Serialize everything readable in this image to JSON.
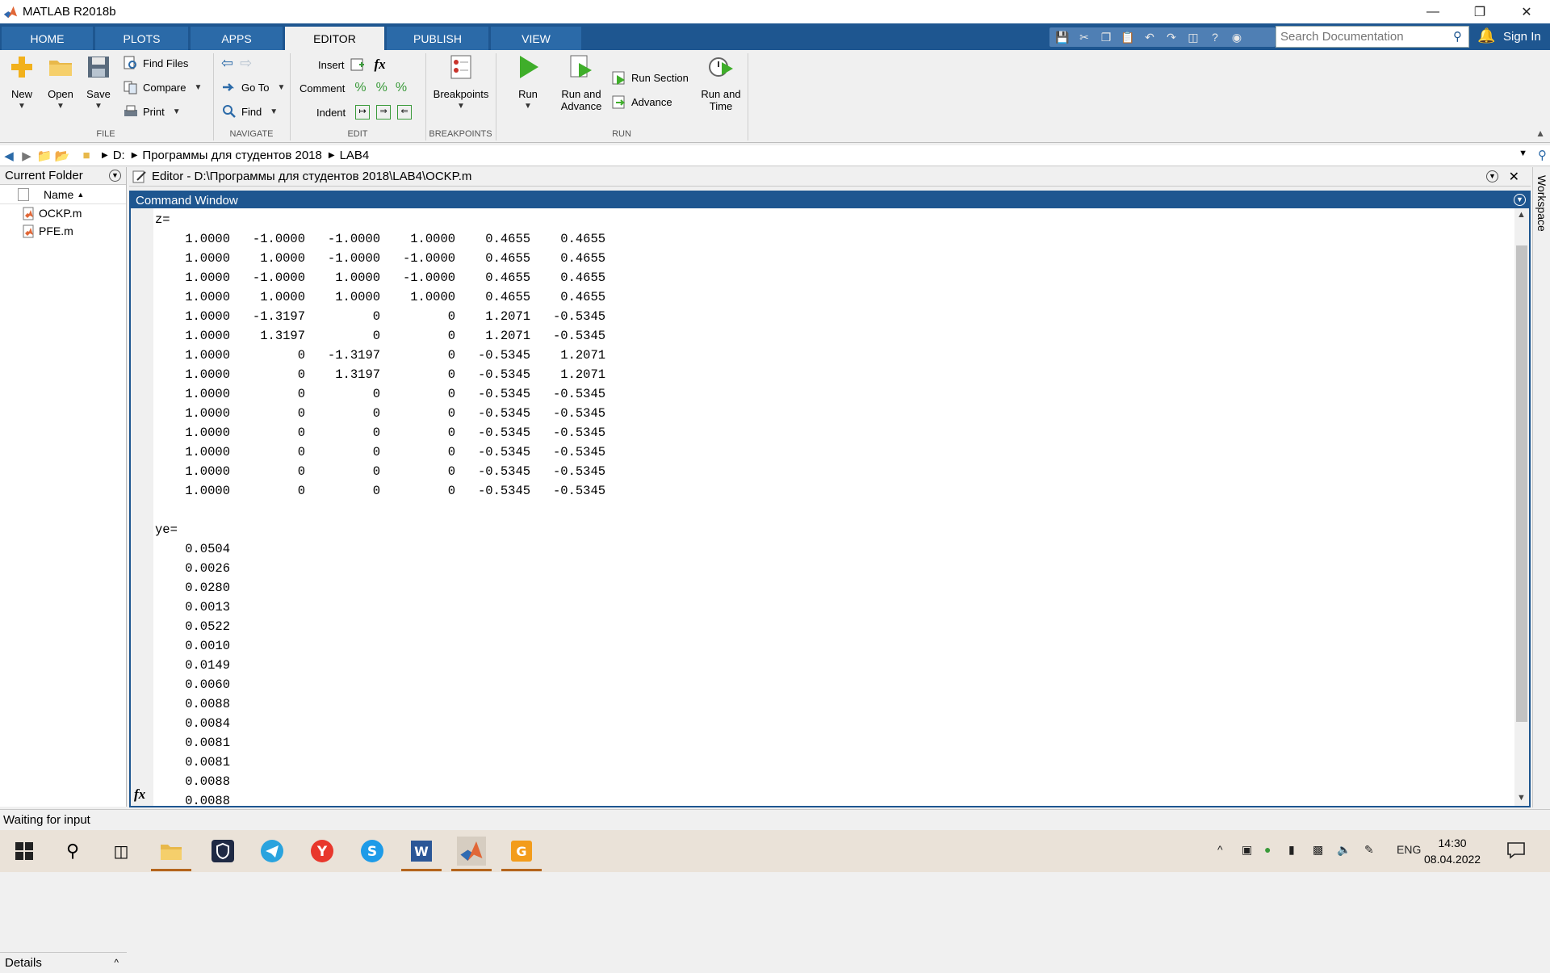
{
  "window": {
    "title": "MATLAB R2018b"
  },
  "tabs": [
    "HOME",
    "PLOTS",
    "APPS",
    "EDITOR",
    "PUBLISH",
    "VIEW"
  ],
  "active_tab": "EDITOR",
  "search": {
    "placeholder": "Search Documentation"
  },
  "signin": "Sign In",
  "ribbon": {
    "file": {
      "group": "FILE",
      "new": "New",
      "open": "Open",
      "save": "Save",
      "find_files": "Find Files",
      "compare": "Compare",
      "print": "Print"
    },
    "navigate": {
      "group": "NAVIGATE",
      "go_to": "Go To",
      "find": "Find"
    },
    "edit": {
      "group": "EDIT",
      "insert": "Insert",
      "comment": "Comment",
      "indent": "Indent"
    },
    "breakpoints": {
      "group": "BREAKPOINTS",
      "label": "Breakpoints"
    },
    "run": {
      "group": "RUN",
      "run": "Run",
      "run_and_advance_1": "Run and",
      "run_and_advance_2": "Advance",
      "run_section": "Run Section",
      "advance": "Advance",
      "run_and_time_1": "Run and",
      "run_and_time_2": "Time"
    }
  },
  "address": {
    "crumbs": [
      "D:",
      "Программы для студентов 2018",
      "LAB4"
    ]
  },
  "current_folder": {
    "title": "Current Folder",
    "column": "Name",
    "files": [
      "OCKP.m",
      "PFE.m"
    ],
    "details": "Details"
  },
  "editor": {
    "title": "Editor - D:\\Программы для студентов 2018\\LAB4\\OCKP.m"
  },
  "workspace_tab": "Workspace",
  "command_window": {
    "title": "Command Window",
    "lines": [
      "z=",
      "    1.0000   -1.0000   -1.0000    1.0000    0.4655    0.4655",
      "    1.0000    1.0000   -1.0000   -1.0000    0.4655    0.4655",
      "    1.0000   -1.0000    1.0000   -1.0000    0.4655    0.4655",
      "    1.0000    1.0000    1.0000    1.0000    0.4655    0.4655",
      "    1.0000   -1.3197         0         0    1.2071   -0.5345",
      "    1.0000    1.3197         0         0    1.2071   -0.5345",
      "    1.0000         0   -1.3197         0   -0.5345    1.2071",
      "    1.0000         0    1.3197         0   -0.5345    1.2071",
      "    1.0000         0         0         0   -0.5345   -0.5345",
      "    1.0000         0         0         0   -0.5345   -0.5345",
      "    1.0000         0         0         0   -0.5345   -0.5345",
      "    1.0000         0         0         0   -0.5345   -0.5345",
      "    1.0000         0         0         0   -0.5345   -0.5345",
      "    1.0000         0         0         0   -0.5345   -0.5345",
      "",
      "ye=",
      "    0.0504",
      "    0.0026",
      "    0.0280",
      "    0.0013",
      "    0.0522",
      "    0.0010",
      "    0.0149",
      "    0.0060",
      "    0.0088",
      "    0.0084",
      "    0.0081",
      "    0.0081",
      "    0.0088",
      "    0.0088"
    ]
  },
  "status": "Waiting for input",
  "taskbar": {
    "lang": "ENG",
    "time": "14:30",
    "date": "08.04.2022"
  },
  "colors": {
    "matlab_blue": "#1e5690",
    "taskbar": "#eae2d8"
  }
}
